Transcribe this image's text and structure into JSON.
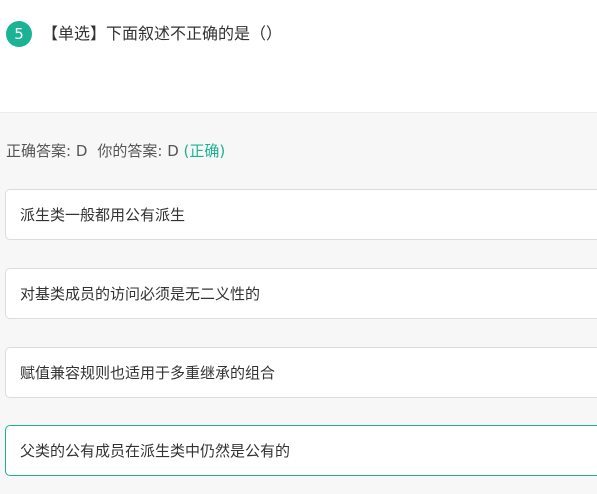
{
  "question": {
    "number": "5",
    "title": "【单选】下面叙述不正确的是（）"
  },
  "answer": {
    "correct_label": "正确答案: D",
    "yours_label": "你的答案: D",
    "status": "(正确)",
    "status_color": "#1bb394"
  },
  "options": [
    {
      "text": "派生类一般都用公有派生",
      "selected": false
    },
    {
      "text": "对基类成员的访问必须是无二义性的",
      "selected": false
    },
    {
      "text": "赋值兼容规则也适用于多重继承的组合",
      "selected": false
    },
    {
      "text": "父类的公有成员在派生类中仍然是公有的",
      "selected": true
    }
  ],
  "colors": {
    "accent": "#1bb394",
    "panel_bg": "#f7f7f7",
    "option_border": "#dcdcdc"
  }
}
